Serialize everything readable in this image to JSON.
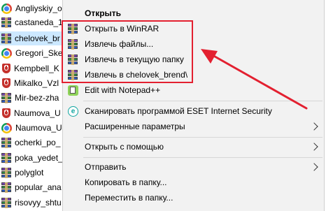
{
  "file_list": [
    {
      "name": "Angliyskiy_o",
      "icon": "chrome-icon",
      "selected": false
    },
    {
      "name": "castaneda_1",
      "icon": "rar-icon",
      "selected": false
    },
    {
      "name": "chelovek_br",
      "icon": "rar-icon",
      "selected": true
    },
    {
      "name": "Gregori_Ske",
      "icon": "chrome-icon",
      "selected": false
    },
    {
      "name": "Kempbell_K",
      "icon": "red-doc-icon",
      "selected": false
    },
    {
      "name": "Mikalko_Vzl",
      "icon": "red-doc-icon",
      "selected": false
    },
    {
      "name": "Mir-bez-zha",
      "icon": "rar-icon",
      "selected": false
    },
    {
      "name": "Naumova_U",
      "icon": "red-doc-icon",
      "selected": false
    },
    {
      "name": "Naumova_U",
      "icon": "chrome-icon",
      "selected": false
    },
    {
      "name": "ocherki_po_",
      "icon": "rar-icon",
      "selected": false
    },
    {
      "name": "poka_yedet_",
      "icon": "rar-icon",
      "selected": false
    },
    {
      "name": "polyglot",
      "icon": "rar-icon",
      "selected": false
    },
    {
      "name": "popular_ana",
      "icon": "rar-icon",
      "selected": false
    },
    {
      "name": "risovyy_shtu",
      "icon": "rar-icon",
      "selected": false
    }
  ],
  "menu": {
    "open": "Открыть",
    "open_winrar": "Открыть в WinRAR",
    "extract_files": "Извлечь файлы...",
    "extract_here": "Извлечь в текущую папку",
    "extract_to": "Извлечь в chelovek_brend\\",
    "edit_npp": "Edit with Notepad++",
    "eset_scan": "Сканировать программой ESET Internet Security",
    "advanced": "Расширенные параметры",
    "open_with": "Открыть с помощью",
    "send_to": "Отправить",
    "copy_to": "Копировать в папку...",
    "move_to": "Переместить в папку..."
  },
  "colors": {
    "highlight": "#e32030",
    "selected_row": "#cce8ff",
    "menu_bg": "#f2f2f2"
  }
}
